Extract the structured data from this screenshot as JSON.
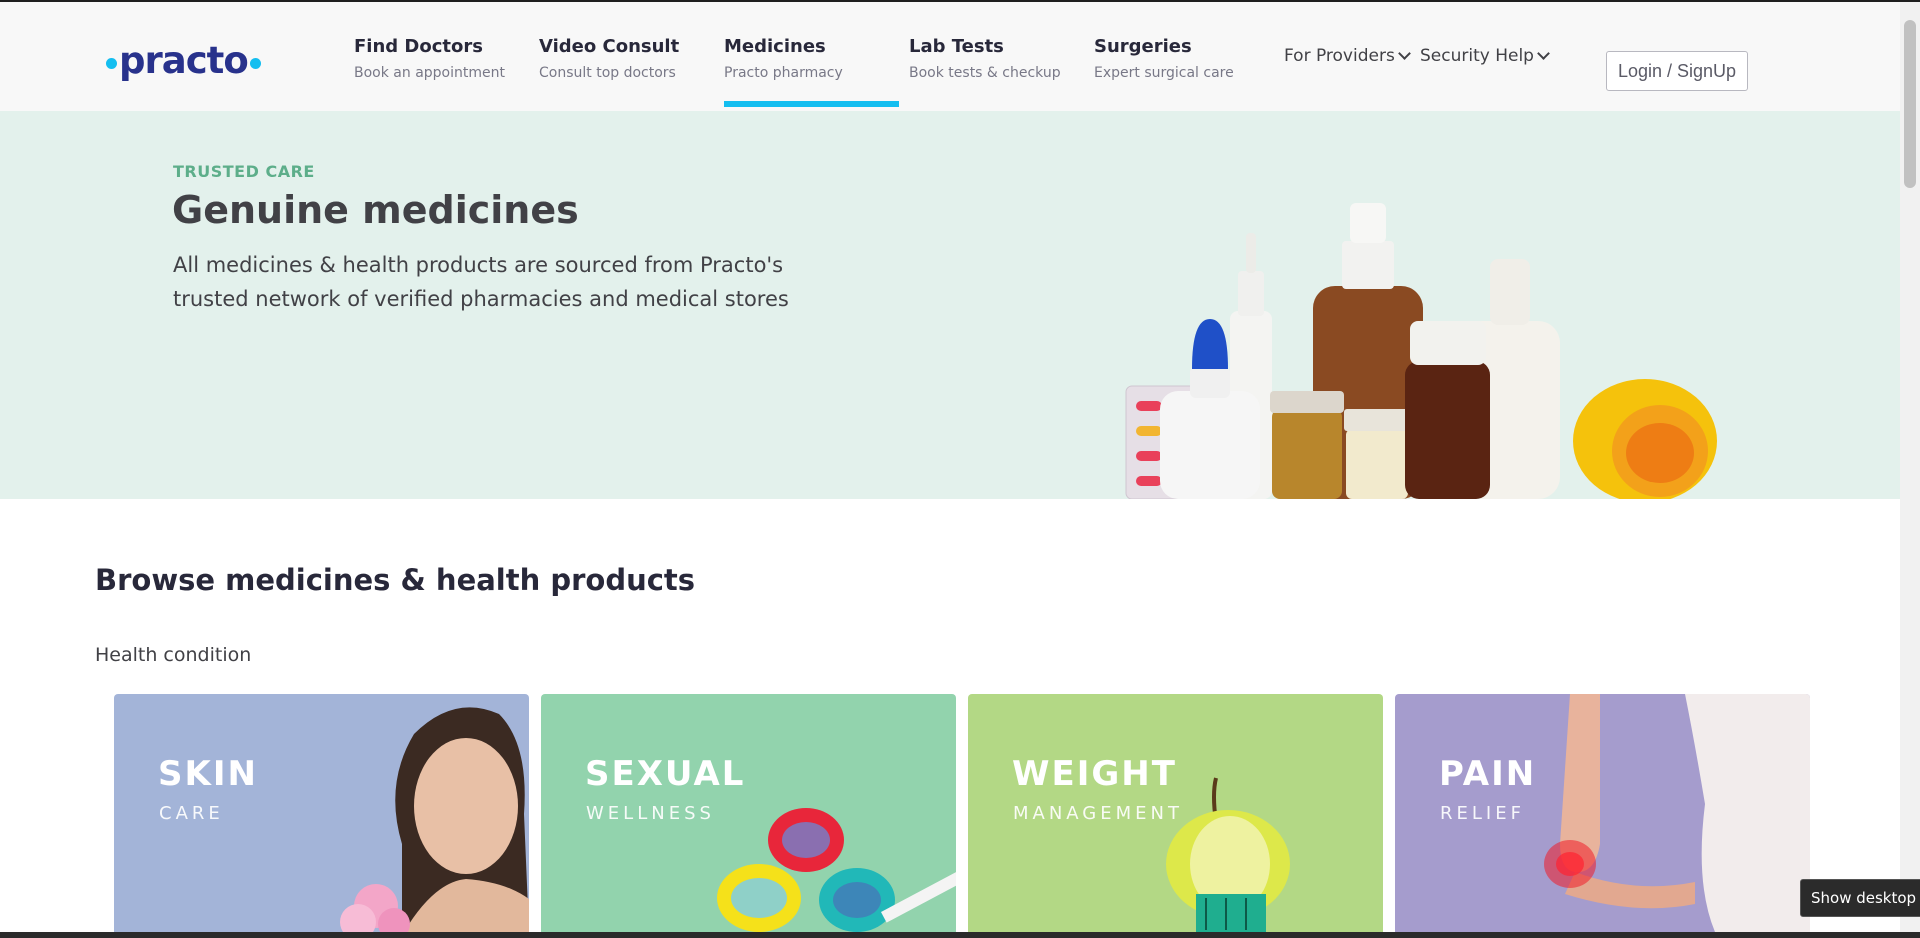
{
  "brand": {
    "logo_text": "practo",
    "accent": "#14bef0",
    "brand_color": "#28328c"
  },
  "nav": {
    "items": [
      {
        "title": "Find Doctors",
        "sub": "Book an appointment"
      },
      {
        "title": "Video Consult",
        "sub": "Consult top doctors"
      },
      {
        "title": "Medicines",
        "sub": "Practo pharmacy",
        "active": true
      },
      {
        "title": "Lab Tests",
        "sub": "Book tests & checkup"
      },
      {
        "title": "Surgeries",
        "sub": "Expert surgical care"
      }
    ],
    "dropdowns": [
      "For Providers",
      "Security Help"
    ],
    "login_label": "Login / SignUp"
  },
  "hero": {
    "kicker": "TRUSTED CARE",
    "headline": "Genuine medicines",
    "description": "All medicines & health products are sourced from Practo's trusted network of verified pharmacies and medical stores",
    "background": "#e3f1ec"
  },
  "browse": {
    "title": "Browse medicines & health products",
    "section_label": "Health condition",
    "cards": [
      {
        "title": "SKIN",
        "sub": "CARE",
        "color": "#a3b4d8"
      },
      {
        "title": "SEXUAL",
        "sub": "WELLNESS",
        "color": "#92d3ad"
      },
      {
        "title": "WEIGHT",
        "sub": "MANAGEMENT",
        "color": "#b3d885"
      },
      {
        "title": "PAIN",
        "sub": "RELIEF",
        "color": "#a59ccd"
      }
    ]
  },
  "taskbar": {
    "tooltip": "Show desktop"
  }
}
